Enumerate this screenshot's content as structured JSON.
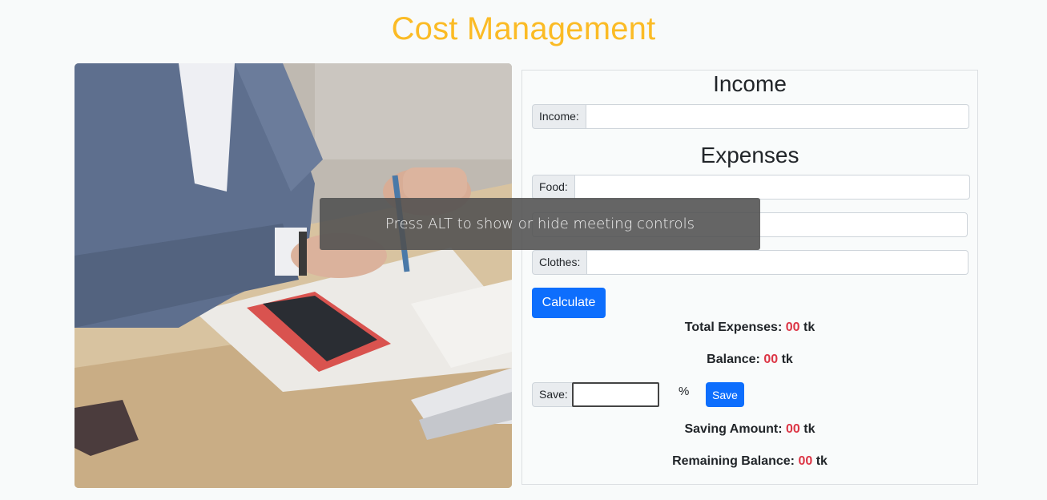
{
  "header": {
    "title": "Cost Management"
  },
  "income": {
    "heading": "Income",
    "income_label": "Income:",
    "income_value": ""
  },
  "expenses": {
    "heading": "Expenses",
    "food_label": "Food:",
    "food_value": "",
    "rent_value": "",
    "clothes_label": "Clothes:",
    "clothes_value": "",
    "calculate_label": "Calculate"
  },
  "results": {
    "total_label": "Total Expenses:",
    "total_value": "00",
    "balance_label": "Balance:",
    "balance_value": "00",
    "currency": "tk"
  },
  "saving": {
    "save_label": "Save:",
    "save_value": "",
    "percent_sign": "%",
    "save_button": "Save",
    "saving_amount_label": "Saving Amount:",
    "saving_amount_value": "00",
    "remaining_label": "Remaining Balance:",
    "remaining_value": "00"
  },
  "overlay": {
    "text": "Press ALT to show or hide meeting controls"
  },
  "colors": {
    "title": "#fbbb25",
    "primary": "#0d6efd",
    "number": "#dc3545"
  }
}
